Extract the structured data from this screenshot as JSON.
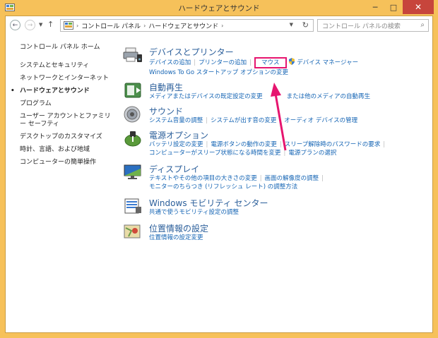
{
  "window": {
    "title": "ハードウェアとサウンド"
  },
  "address": {
    "crumbs": [
      "コントロール パネル",
      "ハードウェアとサウンド"
    ],
    "search_placeholder": "コントロール パネルの検索"
  },
  "leftnav": {
    "home": "コントロール パネル ホーム",
    "items": [
      "システムとセキュリティ",
      "ネットワークとインターネット",
      "ハードウェアとサウンド",
      "プログラム",
      "ユーザー アカウントとファミリー セーフティ",
      "デスクトップのカスタマイズ",
      "時計、言語、および地域",
      "コンピューターの簡単操作"
    ]
  },
  "categories": {
    "devices": {
      "heading": "デバイスとプリンター",
      "links": [
        "デバイスの追加",
        "プリンターの追加",
        "マウス",
        "デバイス マネージャー",
        "Windows To Go スタートアップ オプションの変更"
      ]
    },
    "autoplay": {
      "heading": "自動再生",
      "links": [
        "メディアまたはデバイスの既定設定の変更",
        "または他のメディアの自動再生"
      ]
    },
    "sound": {
      "heading": "サウンド",
      "links": [
        "システム音量の調整",
        "システムが出す音の変更",
        "オーディオ デバイスの管理"
      ]
    },
    "power": {
      "heading": "電源オプション",
      "links": [
        "バッテリ設定の変更",
        "電源ボタンの動作の変更",
        "スリープ解除時のパスワードの要求",
        "コンピューターがスリープ状態になる時間を変更",
        "電源プランの選択"
      ]
    },
    "display": {
      "heading": "ディスプレイ",
      "links": [
        "テキストやその他の項目の大きさの変更",
        "画面の解像度の調整",
        "モニターのちらつき (リフレッシュ レート) の調整方法"
      ]
    },
    "mobility": {
      "heading": "Windows モビリティ センター",
      "links": [
        "共通で使うモビリティ設定の調整"
      ]
    },
    "location": {
      "heading": "位置情報の設定",
      "links": [
        "位置情報の設定変更"
      ]
    }
  },
  "colors": {
    "frame": "#f6c15a",
    "link": "#1464b4",
    "heading": "#2a5e9a",
    "highlight": "#e6156f",
    "close": "#c7453c"
  }
}
